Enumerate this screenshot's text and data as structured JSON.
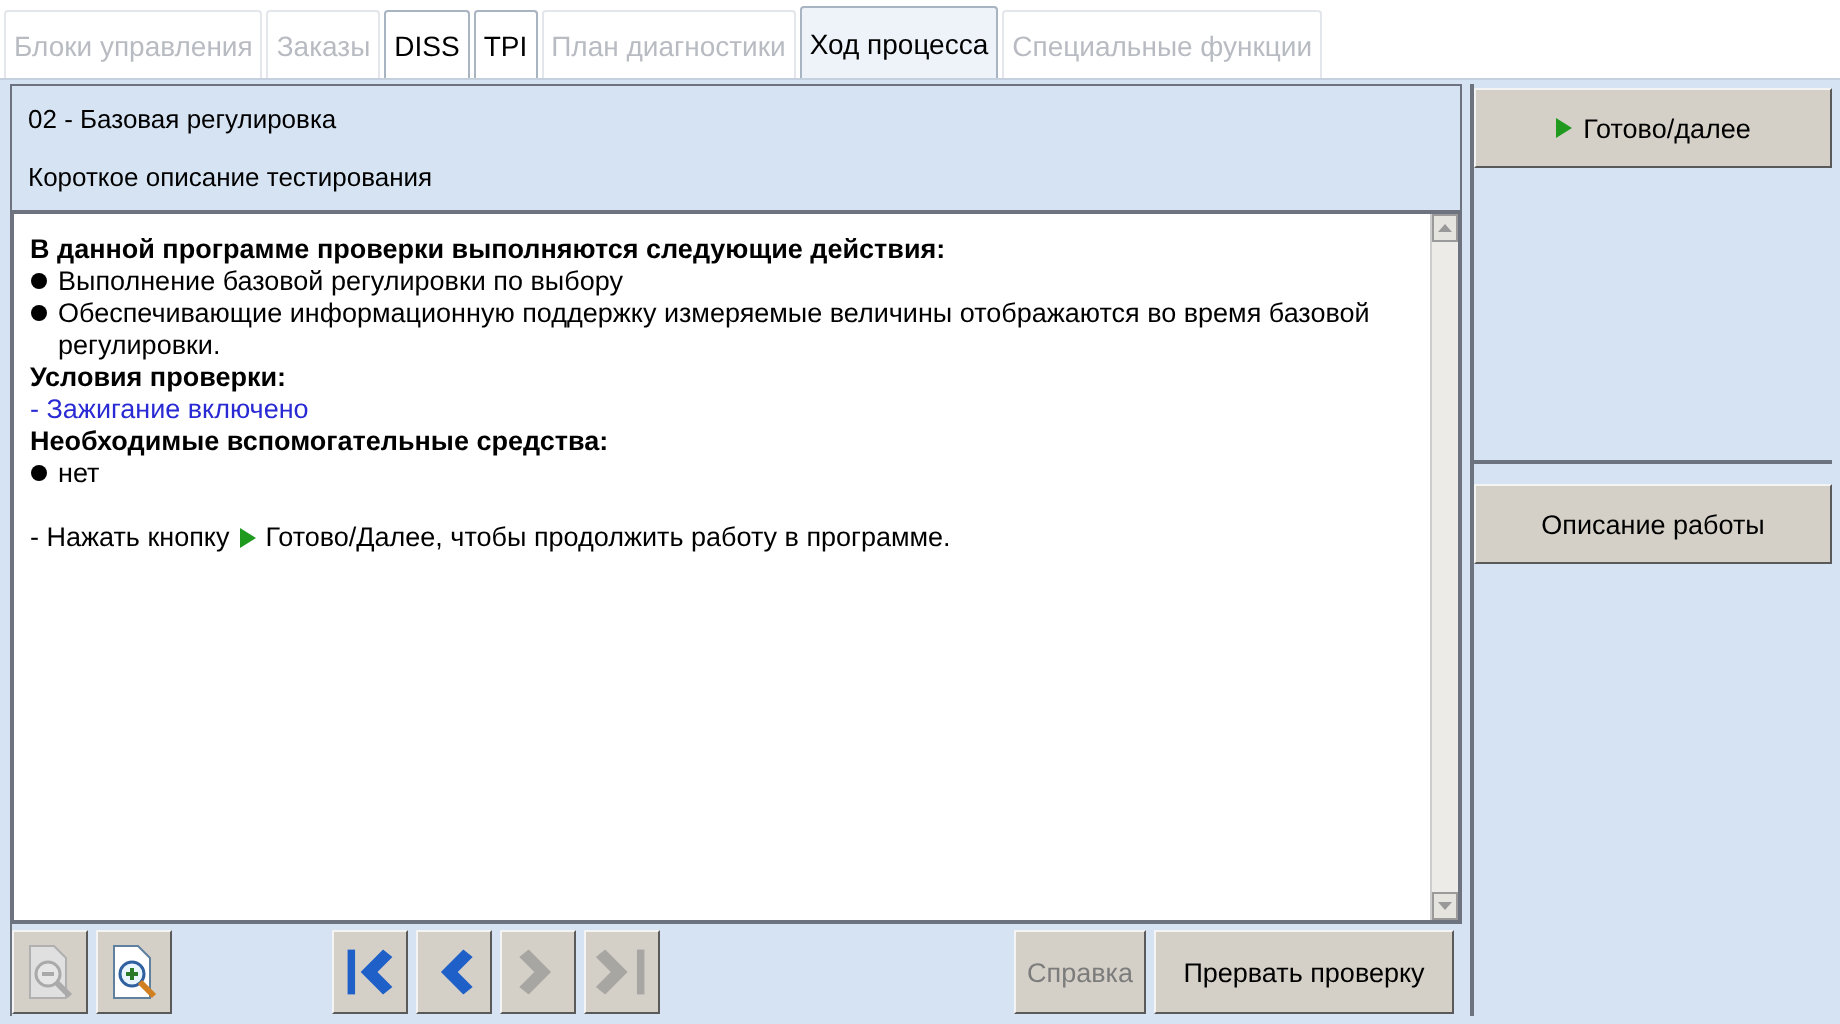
{
  "tabs": [
    {
      "label": "Блоки управления",
      "disabled": true,
      "selected": false
    },
    {
      "label": "Заказы",
      "disabled": true,
      "selected": false
    },
    {
      "label": "DISS",
      "disabled": false,
      "selected": false
    },
    {
      "label": "TPI",
      "disabled": false,
      "selected": false
    },
    {
      "label": "План диагностики",
      "disabled": true,
      "selected": false
    },
    {
      "label": "Ход процесса",
      "disabled": false,
      "selected": true
    },
    {
      "label": "Специальные функции",
      "disabled": true,
      "selected": false
    }
  ],
  "header": {
    "title": "02 - Базовая регулировка",
    "subtitle": "Короткое описание тестирования"
  },
  "content": [
    {
      "kind": "heading",
      "text": "В данной программе проверки выполняются следующие действия:"
    },
    {
      "kind": "bullet",
      "text": "Выполнение базовой регулировки по выбору"
    },
    {
      "kind": "bullet",
      "text": "Обеспечивающие информационную поддержку измеряемые величины отображаются во время базовой регулировки."
    },
    {
      "kind": "heading",
      "text": "Условия проверки:"
    },
    {
      "kind": "condition",
      "text": "- Зажигание включено"
    },
    {
      "kind": "heading",
      "text": "Необходимые вспомогательные средства:"
    },
    {
      "kind": "bullet",
      "text": "нет"
    },
    {
      "kind": "blank"
    },
    {
      "kind": "instruction",
      "before": "- Нажать кнопку",
      "after": "Готово/Далее, чтобы продолжить работу в программе."
    }
  ],
  "toolbar": {
    "zoom": [
      {
        "kind": "zoom-out",
        "disabled": true
      },
      {
        "kind": "zoom-in",
        "disabled": false
      }
    ],
    "navigation": [
      {
        "kind": "first",
        "disabled": false
      },
      {
        "kind": "previous",
        "disabled": false
      },
      {
        "kind": "next",
        "disabled": true
      },
      {
        "kind": "last",
        "disabled": true
      }
    ],
    "buttons": [
      {
        "label": "Справка",
        "disabled": true
      },
      {
        "label": "Прервать проверку",
        "disabled": false
      }
    ]
  },
  "sidebar": {
    "top_button": {
      "label": "Готово/далее"
    },
    "bottom_button": {
      "label": "Описание работы"
    }
  }
}
